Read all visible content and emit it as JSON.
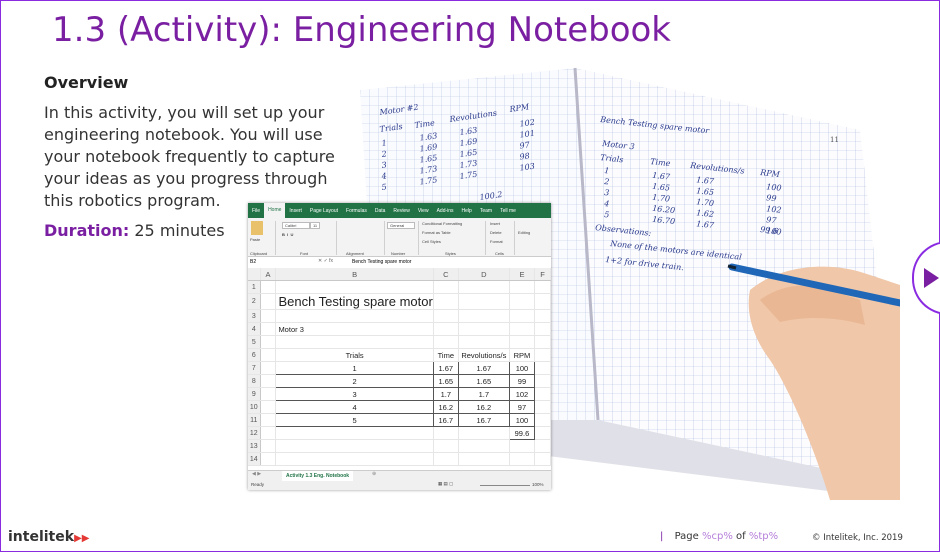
{
  "slide": {
    "title": "1.3 (Activity): Engineering Notebook",
    "overview_heading": "Overview",
    "overview_text": "In this activity, you will set up your engineering notebook. You will use your notebook frequently to capture your ideas as you progress through this robotics program.",
    "duration_label": "Duration:",
    "duration_value": "25 minutes"
  },
  "excel": {
    "tabs": [
      "File",
      "Home",
      "Insert",
      "Page Layout",
      "Formulas",
      "Data",
      "Review",
      "View",
      "Add-ins",
      "Help",
      "Team",
      "Tell me"
    ],
    "ribbon": {
      "font_name": "Calibri",
      "font_size": "11",
      "number_format": "General",
      "conditional": "Conditional Formatting",
      "format_table": "Format as Table",
      "cell_styles": "Cell Styles",
      "insert": "Insert",
      "delete": "Delete",
      "format": "Format",
      "editing": "Editing",
      "paste": "Paste",
      "groups": [
        "Clipboard",
        "Font",
        "Alignment",
        "Number",
        "Styles",
        "Cells"
      ]
    },
    "name_box": "B2",
    "formula": "Bench Testing spare motor",
    "columns": [
      "A",
      "B",
      "C",
      "D",
      "E",
      "F"
    ],
    "sheet_title": "Bench Testing spare motor",
    "motor_label": "Motor 3",
    "table_headers": [
      "Trials",
      "Time",
      "Revolutions/s",
      "RPM"
    ],
    "rows": [
      [
        "1",
        "1.67",
        "1.67",
        "100"
      ],
      [
        "2",
        "1.65",
        "1.65",
        "99"
      ],
      [
        "3",
        "1.7",
        "1.7",
        "102"
      ],
      [
        "4",
        "16.2",
        "16.2",
        "97"
      ],
      [
        "5",
        "16.7",
        "16.7",
        "100"
      ]
    ],
    "average": "99.6",
    "sheet_tab": "Activity 1.3 Eng. Notebook",
    "status": "Ready",
    "zoom": "100%"
  },
  "footer": {
    "logo": "intelitek",
    "page_label": "Page",
    "page_current": "%cp%",
    "page_of": "of",
    "page_total": "%tp%",
    "copyright": "© Intelitek, Inc. 2019"
  },
  "notebook": {
    "heading": "Bench Testing spare motor",
    "motor": "Motor 3",
    "headers": [
      "Trials",
      "Time",
      "Revolutions/s",
      "RPM"
    ],
    "rows": [
      [
        "1",
        "1.67",
        "1.67",
        "100"
      ],
      [
        "2",
        "1.65",
        "1.65",
        "99"
      ],
      [
        "3",
        "1.70",
        "1.70",
        "102"
      ],
      [
        "4",
        "16.20",
        "1.62",
        "97"
      ],
      [
        "5",
        "16.70",
        "1.67",
        "100"
      ]
    ],
    "avg": "99.6",
    "observations": "Observations:",
    "note1": "None of the motors are identical",
    "note2": "1+2 for drive train.",
    "page_num": "11",
    "left_motor": "Motor #2",
    "left_headers": [
      "Trials",
      "Time",
      "Revolutions",
      "RPM"
    ],
    "left_rows": [
      [
        "1",
        "1.63",
        "1.63",
        "102"
      ],
      [
        "2",
        "1.69",
        "1.69",
        "101"
      ],
      [
        "3",
        "1.65",
        "1.65",
        "97"
      ],
      [
        "4",
        "1.73",
        "1.73",
        "98"
      ],
      [
        "5",
        "1.75",
        "1.75",
        "103"
      ]
    ],
    "left_avg": "100.2"
  },
  "colors": {
    "accent": "#7a1fa2",
    "excel_green": "#217346"
  }
}
